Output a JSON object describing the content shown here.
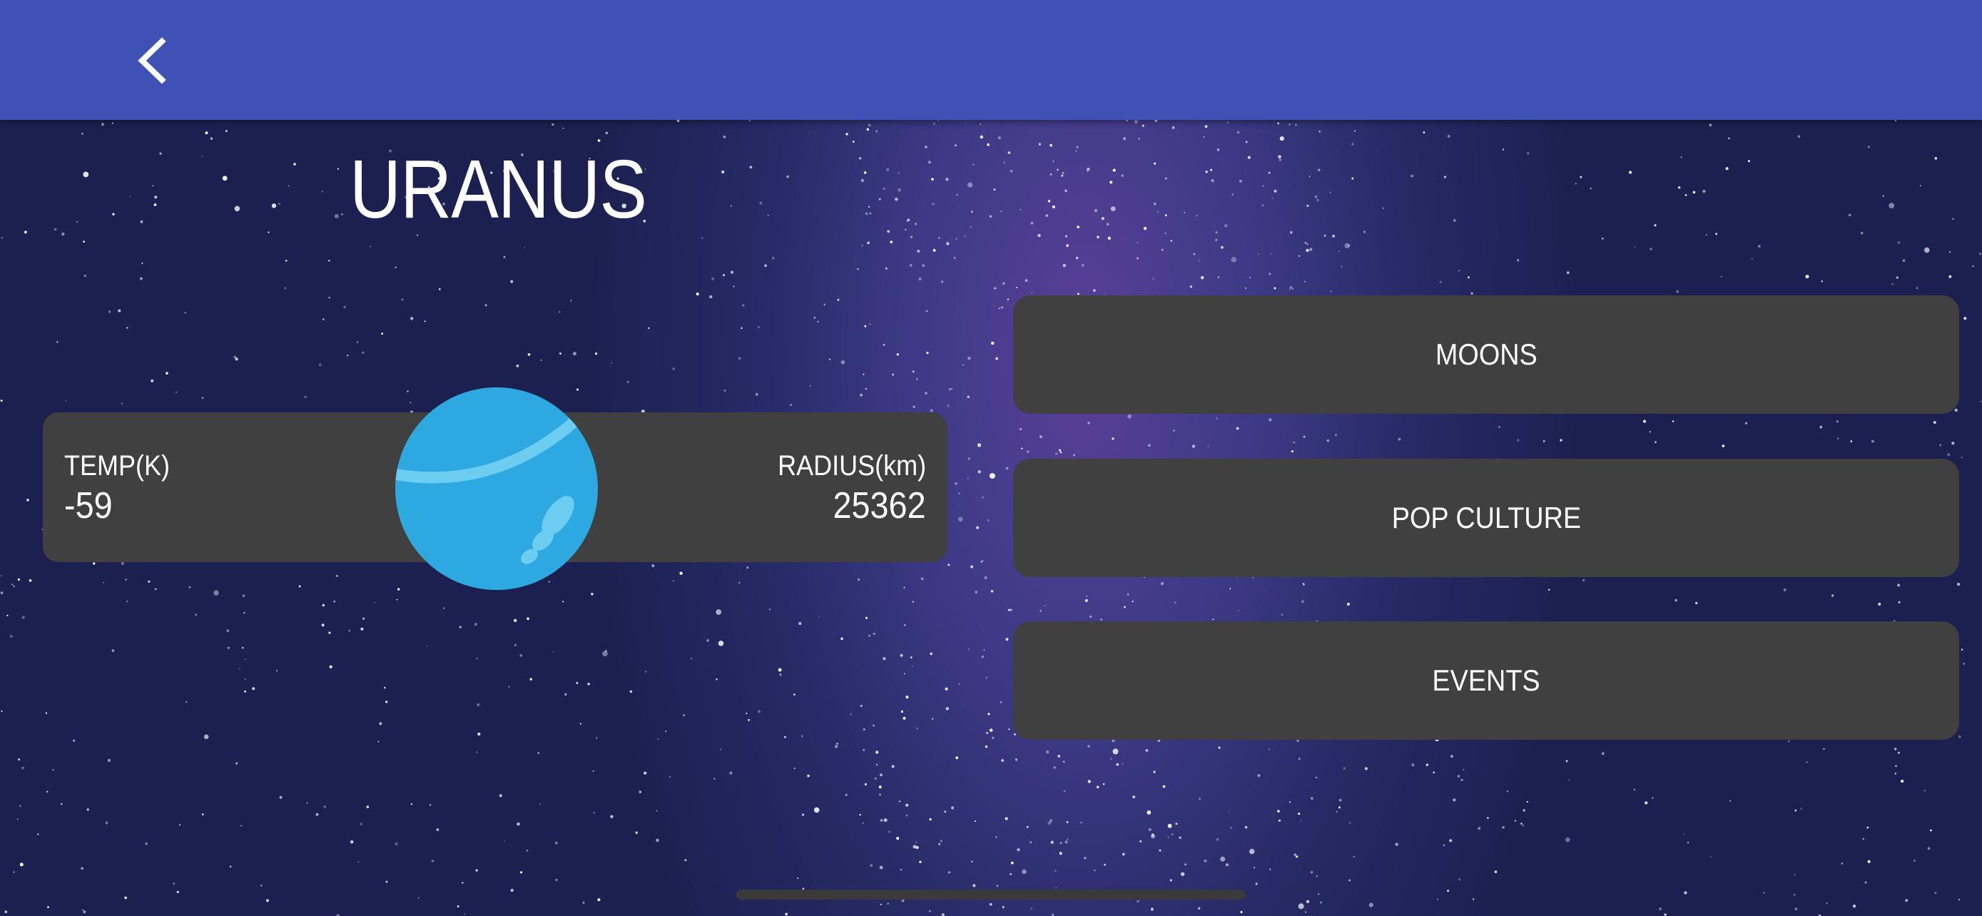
{
  "app_bar": {
    "color": "#3f51b5",
    "back_icon": "chevron-left-icon"
  },
  "background": {
    "description_icon": "starfield-background"
  },
  "planet": {
    "name": "URANUS",
    "icon": "uranus-planet-icon",
    "color": "#2ea8e0"
  },
  "stats": {
    "temp_label": "TEMP(K)",
    "temp_value": "-59",
    "radius_label": "RADIUS(km)",
    "radius_value": "25362"
  },
  "menu": {
    "moons_label": "MOONS",
    "pop_culture_label": "POP CULTURE",
    "events_label": "EVENTS",
    "button_color": "#404040"
  }
}
